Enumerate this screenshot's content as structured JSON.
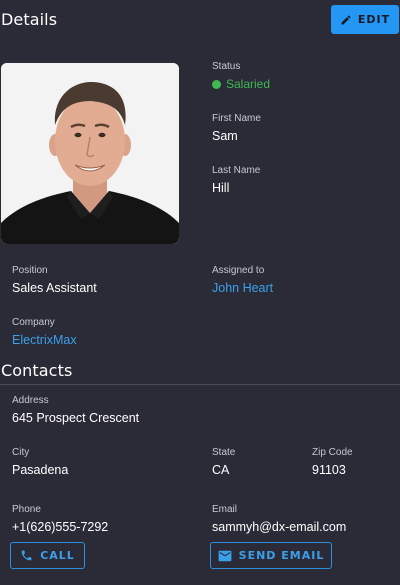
{
  "details": {
    "title": "Details",
    "edit_label": "EDIT",
    "status_label": "Status",
    "status_value": "Salaried",
    "status_color": "#3fb950",
    "first_name_label": "First Name",
    "first_name": "Sam",
    "last_name_label": "Last Name",
    "last_name": "Hill",
    "position_label": "Position",
    "position": "Sales Assistant",
    "assigned_label": "Assigned to",
    "assigned_to": "John Heart",
    "company_label": "Company",
    "company": "ElectrixMax"
  },
  "contacts": {
    "title": "Contacts",
    "address_label": "Address",
    "address": "645 Prospect Crescent",
    "city_label": "City",
    "city": "Pasadena",
    "state_label": "State",
    "state": "CA",
    "zip_label": "Zip Code",
    "zip": "91103",
    "phone_label": "Phone",
    "phone": "+1(626)555-7292",
    "email_label": "Email",
    "email": "sammyh@dx-email.com",
    "call_label": "CALL",
    "send_email_label": "SEND EMAIL"
  },
  "icons": {
    "edit": "pencil-icon",
    "call": "phone-icon",
    "email": "mail-icon"
  },
  "colors": {
    "background": "#2b2b38",
    "accent": "#2496f3",
    "link": "#3aa0ea"
  }
}
